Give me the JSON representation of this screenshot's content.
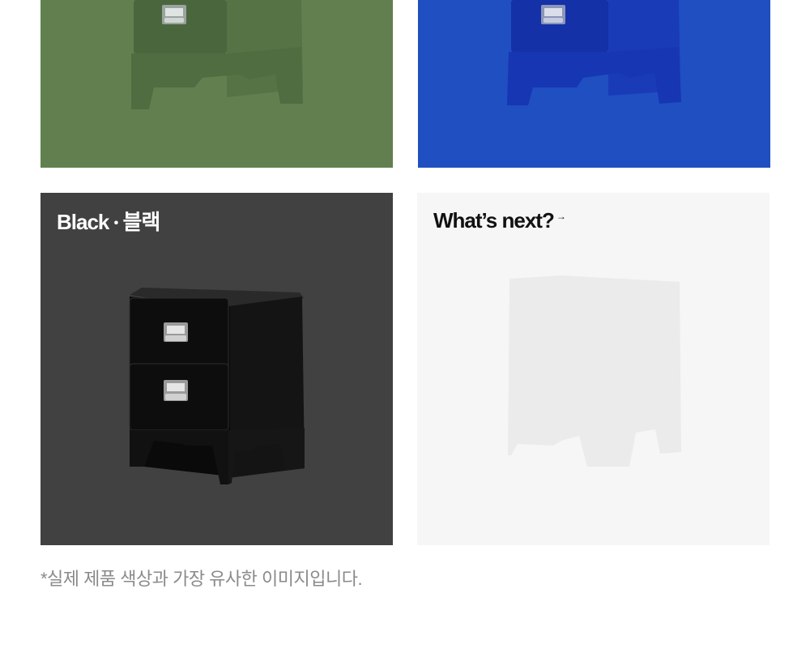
{
  "tiles": {
    "green": {
      "color": "#62804f",
      "product_color": "#4f6d40"
    },
    "blue": {
      "color": "#1f4fc0",
      "product_color": "#1736b3"
    },
    "black": {
      "title_en": "Black",
      "separator": "•",
      "title_ko": "블랙",
      "color": "#414141",
      "product_color": "#0c0c0c"
    },
    "next": {
      "title": "What’s next?",
      "arrow": "→",
      "color": "#f6f6f6",
      "silhouette_color": "#ebebeb"
    }
  },
  "footnote": "*실제 제품 색상과 가장 유사한 이미지입니다.",
  "icons": [
    "drawer-handle-icon",
    "arrow-icon"
  ]
}
